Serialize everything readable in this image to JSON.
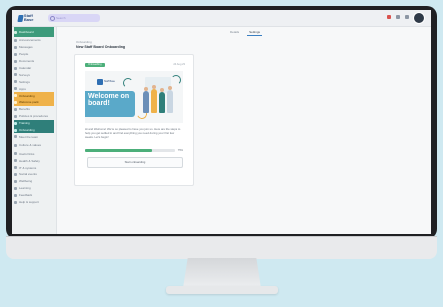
{
  "app": {
    "logo_text": "Staff Base"
  },
  "search": {
    "placeholder": "Search"
  },
  "sidebar": {
    "items": [
      {
        "label": "Dashboard",
        "style": "green",
        "tall": true
      },
      {
        "label": "Announcements"
      },
      {
        "label": "Messages"
      },
      {
        "label": "People"
      },
      {
        "label": "Documents"
      },
      {
        "label": "Calendar"
      },
      {
        "label": "Surveys"
      },
      {
        "label": "Settings"
      },
      {
        "label": "Apps"
      },
      {
        "label": "Onboarding",
        "style": "orange"
      },
      {
        "label": "Welcome pack",
        "style": "orange"
      },
      {
        "label": "Benefits"
      },
      {
        "label": "Policies & procedures"
      },
      {
        "label": "Training",
        "style": "teal"
      },
      {
        "label": "Onboarding",
        "style": "teal"
      },
      {
        "label": "Meet the team"
      },
      {
        "label": "Culture & values",
        "tall": true
      },
      {
        "label": "Useful links"
      },
      {
        "label": "Health & Safety"
      },
      {
        "label": "IT & systems"
      },
      {
        "label": "Social events"
      },
      {
        "label": "Wellbeing"
      },
      {
        "label": "Learning"
      },
      {
        "label": "Feedback"
      },
      {
        "label": "Help & support"
      }
    ]
  },
  "tabs": [
    {
      "label": "Details",
      "active": false
    },
    {
      "label": "Settings",
      "active": true
    }
  ],
  "breadcrumb": "Onboarding",
  "page_title": "New Staff Board Onboarding",
  "card": {
    "tag": "Onboarding",
    "meta": "24 Aug 23",
    "banner_title": "Welcome on board!",
    "banner_logo": "Staff Base",
    "text": "Hi and Welcome! We're so pleased to have you join us. Here are the steps to help you get settled in and find everything you need during your first few weeks. Let's begin!",
    "progress_label": "75%",
    "progress_percent": 75,
    "cta_label": "Start onboarding"
  },
  "colors": {
    "accent": "#4caf7a",
    "brand": "#2f6fb3",
    "banner": "#5aa9c9"
  }
}
